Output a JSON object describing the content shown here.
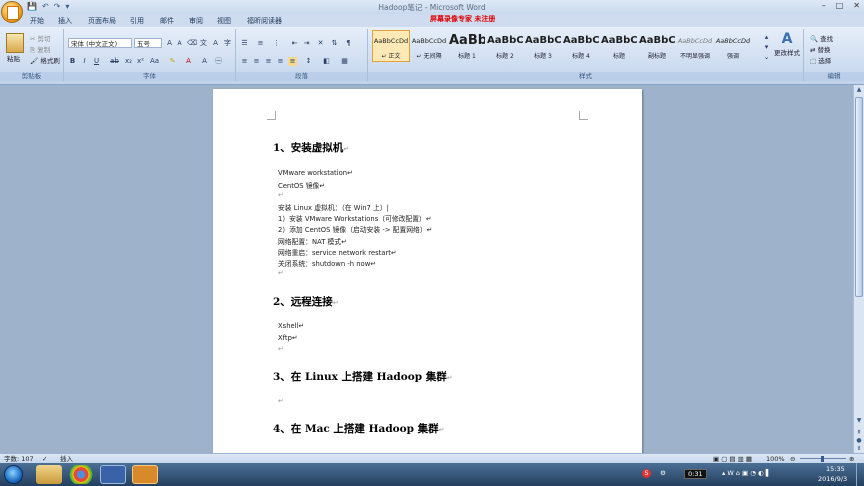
{
  "window": {
    "title": "Hadoop笔记 - Microsoft Word",
    "banner": "屏幕录像专家  未注册"
  },
  "qat": [
    "💾",
    "↶",
    "↷",
    "▾"
  ],
  "window_controls": [
    "–",
    "□",
    "✕"
  ],
  "tabs": [
    "开始",
    "插入",
    "页面布局",
    "引用",
    "邮件",
    "审阅",
    "视图",
    "福昕阅读器"
  ],
  "clipboard": {
    "paste": "粘贴",
    "cut": "剪切",
    "copy": "复制",
    "format_painter": "格式刷",
    "label": "剪贴板"
  },
  "font": {
    "name": "宋体 (中文正文)",
    "size": "五号",
    "label": "字体"
  },
  "paragraph": {
    "label": "段落"
  },
  "styles": {
    "label": "样式",
    "items": [
      {
        "sample": "AaBbCcDd",
        "name": "↵ 正文",
        "active": true
      },
      {
        "sample": "AaBbCcDd",
        "name": "↵ 无间隔"
      },
      {
        "sample": "AaBb",
        "name": "标题 1"
      },
      {
        "sample": "AaBbC",
        "name": "标题 2"
      },
      {
        "sample": "AaBbC",
        "name": "标题 3"
      },
      {
        "sample": "AaBbC",
        "name": "标题 4"
      },
      {
        "sample": "AaBbC",
        "name": "标题"
      },
      {
        "sample": "AaBbC",
        "name": "副标题"
      },
      {
        "sample": "AaBbCcDd",
        "name": "不明显强调"
      },
      {
        "sample": "AaBbCcDd",
        "name": "强调"
      }
    ],
    "change_styles": "更改样式"
  },
  "editing": {
    "find": "查找",
    "replace": "替换",
    "select": "选择",
    "label": "编辑"
  },
  "document": {
    "headings": [
      "1、安装虚拟机",
      "2、远程连接",
      "3、在 Linux 上搭建 Hadoop 集群",
      "4、在 Mac 上搭建 Hadoop 集群"
    ],
    "section1_lines": [
      "VMware workstation↵",
      "CentOS 镜像↵",
      "↵",
      "安装 Linux 虚拟机：（在 Win7 上）|",
      "1）安装 VMware Workstations（可修改配置）↵",
      "2）添加 CentOS 镜像（启动安装 -> 配置网络）↵",
      "网络配置：NAT 模式↵",
      "网络重启：service network restart↵",
      "关闭系统：shutdown -h now↵",
      "↵"
    ],
    "section2_lines": [
      "Xshell↵",
      "Xftp↵",
      "↵"
    ],
    "section3_lines": [
      "↵"
    ],
    "paragraph_mark": "↵"
  },
  "statusbar": {
    "word_count": "字数: 107",
    "mode": "插入",
    "zoom": "100%"
  },
  "taskbar": {
    "clock_time": "15:35",
    "clock_date": "2016/9/3",
    "recording": "0:31"
  }
}
